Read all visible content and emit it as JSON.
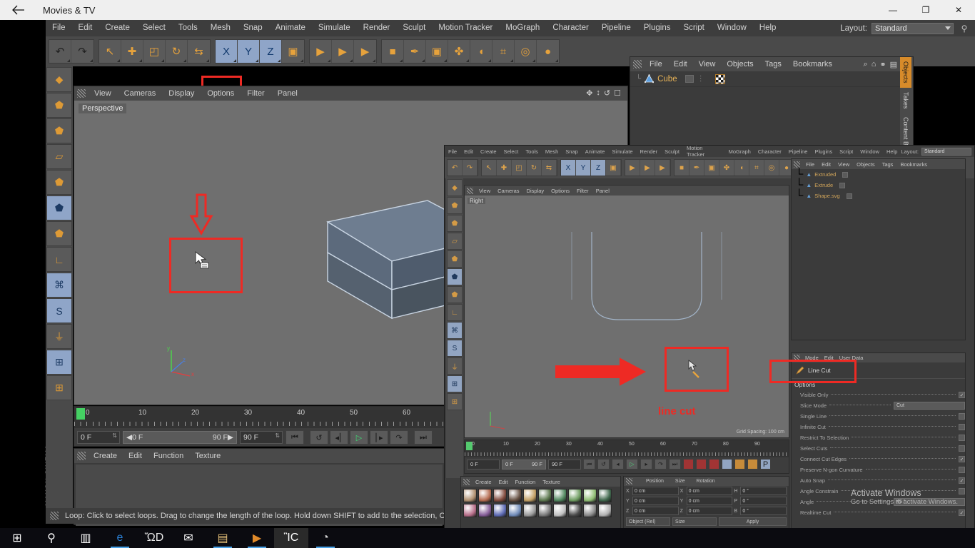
{
  "window": {
    "app_title": "Movies & TV",
    "back_icon": "back-arrow-icon",
    "minimize": "—",
    "maximize": "❐",
    "close": "✕"
  },
  "c4d": {
    "menu": [
      "File",
      "Edit",
      "Create",
      "Select",
      "Tools",
      "Mesh",
      "Snap",
      "Animate",
      "Simulate",
      "Render",
      "Sculpt",
      "Motion Tracker",
      "MoGraph",
      "Character",
      "Pipeline",
      "Plugins",
      "Script",
      "Window",
      "Help"
    ],
    "layout_label": "Layout:",
    "layout_value": "Standard",
    "search_icon": "search-icon",
    "brand": "MAXON CINEMA 4D",
    "status_text": "Loop: Click to select loops. Drag to change the length of the loop. Hold down SHIFT to add to the selection, CTR"
  },
  "toolbar": {
    "groups": [
      {
        "name": "undo-redo",
        "items": [
          {
            "icon": "undo-icon",
            "glyph": "↶",
            "selected": false
          },
          {
            "icon": "redo-icon",
            "glyph": "↷",
            "selected": false
          }
        ]
      },
      {
        "name": "transform",
        "items": [
          {
            "icon": "live-selection-icon",
            "glyph": "↖",
            "selected": false
          },
          {
            "icon": "move-icon",
            "glyph": "✚",
            "selected": false
          },
          {
            "icon": "scale-icon",
            "glyph": "◰",
            "selected": false
          },
          {
            "icon": "rotate-icon",
            "glyph": "↻",
            "selected": false
          },
          {
            "icon": "loop-selection-icon",
            "glyph": "⇆",
            "selected": false
          }
        ]
      },
      {
        "name": "axis-lock",
        "items": [
          {
            "icon": "axis-x-icon",
            "glyph": "X",
            "selected": true
          },
          {
            "icon": "axis-y-icon",
            "glyph": "Y",
            "selected": true
          },
          {
            "icon": "axis-z-icon",
            "glyph": "Z",
            "selected": true
          },
          {
            "icon": "world-object-axis-icon",
            "glyph": "▣",
            "selected": false
          }
        ]
      },
      {
        "name": "render",
        "items": [
          {
            "icon": "render-view-icon",
            "glyph": "▶",
            "selected": false
          },
          {
            "icon": "render-region-icon",
            "glyph": "▶",
            "selected": false
          },
          {
            "icon": "render-settings-icon",
            "glyph": "▶",
            "selected": false
          }
        ]
      },
      {
        "name": "objects",
        "items": [
          {
            "icon": "cube-primitive-icon",
            "glyph": "■",
            "selected": false
          },
          {
            "icon": "spline-pen-icon",
            "glyph": "✒",
            "selected": false
          },
          {
            "icon": "generator-icon",
            "glyph": "▣",
            "selected": false
          },
          {
            "icon": "mograph-icon",
            "glyph": "✤",
            "selected": false
          },
          {
            "icon": "deformer-icon",
            "glyph": "◖",
            "selected": false
          },
          {
            "icon": "scene-grid-icon",
            "glyph": "⌗",
            "selected": false
          },
          {
            "icon": "camera-icon",
            "glyph": "◎",
            "selected": false
          },
          {
            "icon": "light-icon",
            "glyph": "●",
            "selected": false
          }
        ]
      }
    ],
    "highlighted_tool": "loop-selection-icon"
  },
  "left_toolbar": [
    {
      "icon": "model-mode-icon",
      "glyph": "◆",
      "selected": false
    },
    {
      "icon": "object-mode-icon",
      "glyph": "⬟",
      "selected": false
    },
    {
      "icon": "texture-mode-icon",
      "glyph": "⬟",
      "selected": false
    },
    {
      "icon": "workplane-mode-icon",
      "glyph": "▱",
      "selected": false
    },
    {
      "icon": "point-mode-icon",
      "glyph": "⬟",
      "selected": false
    },
    {
      "icon": "edge-mode-icon",
      "glyph": "⬟",
      "selected": true
    },
    {
      "icon": "polygon-mode-icon",
      "glyph": "⬟",
      "selected": false
    },
    {
      "icon": "axis-mode-icon",
      "glyph": "∟",
      "selected": false
    },
    {
      "icon": "viewport-solo-icon",
      "glyph": "⌘",
      "selected": true
    },
    {
      "icon": "snap-toggle-icon",
      "glyph": "S",
      "selected": true
    },
    {
      "icon": "magnet-icon",
      "glyph": "⏚",
      "selected": false
    },
    {
      "icon": "workplane-lock-icon",
      "glyph": "⊞",
      "selected": true
    },
    {
      "icon": "workplane-grid-icon",
      "glyph": "⊞",
      "selected": false
    }
  ],
  "viewport": {
    "menu": [
      "View",
      "Cameras",
      "Display",
      "Options",
      "Filter",
      "Panel"
    ],
    "label": "Perspective",
    "axis_labels": {
      "x": "x",
      "y": "y",
      "z": "z"
    },
    "nav_icons": [
      "pan-icon",
      "zoom-icon",
      "rotate-icon",
      "maximize-icon"
    ]
  },
  "object_manager": {
    "menu": [
      "File",
      "Edit",
      "View",
      "Objects",
      "Tags",
      "Bookmarks"
    ],
    "items": [
      {
        "name": "Cube",
        "icon": "cube-object-icon"
      }
    ],
    "header_icons": [
      "search-icon",
      "home-icon",
      "link-icon",
      "layers-icon"
    ],
    "side_tabs": [
      "Objects",
      "Takes",
      "Content Browser"
    ]
  },
  "timeline": {
    "ticks": [
      "0",
      "10",
      "20",
      "30",
      "40",
      "50",
      "60"
    ],
    "current_frame": "0 F",
    "range_start": "0 F",
    "range_end": "90 F",
    "end_frame": "90 F",
    "buttons": [
      "go-to-start-icon",
      "loop-icon",
      "step-back-icon",
      "play-icon",
      "step-forward-icon",
      "record-icon",
      "go-to-end-icon"
    ]
  },
  "material_manager": {
    "menu": [
      "Create",
      "Edit",
      "Function",
      "Texture"
    ]
  },
  "coordinate_manager": {
    "title": "Position",
    "rows": [
      {
        "label": "X",
        "value": "0 cm"
      },
      {
        "label": "Y",
        "value": "0 cm"
      },
      {
        "label": "Z",
        "value": "0 cm"
      }
    ],
    "mode": "Object ("
  },
  "inner_window": {
    "menu": [
      "File",
      "Edit",
      "Create",
      "Select",
      "Tools",
      "Mesh",
      "Snap",
      "Animate",
      "Simulate",
      "Render",
      "Sculpt",
      "Motion Tracker",
      "MoGraph",
      "Character",
      "Pipeline",
      "Plugins",
      "Script",
      "Window",
      "Help"
    ],
    "layout_label": "Layout:",
    "layout_value": "Standard",
    "viewport": {
      "menu": [
        "View",
        "Cameras",
        "Display",
        "Options",
        "Filter",
        "Panel"
      ],
      "label": "Right",
      "grid_text": "Grid Spacing: 100 cm"
    },
    "object_manager": {
      "menu": [
        "File",
        "Edit",
        "View",
        "Objects",
        "Tags",
        "Bookmarks"
      ],
      "items": [
        {
          "name": "Extruded",
          "icon": "polygon-object-icon"
        },
        {
          "name": "Extrude",
          "icon": "extrude-generator-icon"
        },
        {
          "name": "Shape.svg",
          "icon": "spline-object-icon"
        }
      ]
    },
    "attributes": {
      "menu": [
        "Mode",
        "Edit",
        "User Data"
      ],
      "tool_title": "Line Cut",
      "tool_icon": "line-cut-icon",
      "section": "Options",
      "options": [
        {
          "label": "Visible Only",
          "type": "check",
          "checked": true
        },
        {
          "label": "Slice Mode",
          "type": "dropdown",
          "value": "Cut"
        },
        {
          "label": "Single Line",
          "type": "check",
          "checked": false
        },
        {
          "label": "Infinite Cut",
          "type": "check",
          "checked": false
        },
        {
          "label": "Restrict To Selection",
          "type": "check",
          "checked": false
        },
        {
          "label": "Select Cuts",
          "type": "check",
          "checked": false
        },
        {
          "label": "Connect Cut Edges",
          "type": "check",
          "checked": true
        },
        {
          "label": "Preserve N-gon Curvature",
          "type": "check",
          "checked": false
        },
        {
          "label": "Auto Snap",
          "type": "check",
          "checked": true
        },
        {
          "label": "Angle Constrain",
          "type": "check",
          "checked": false
        },
        {
          "label": "Angle",
          "type": "field",
          "value": "45 °"
        },
        {
          "label": "Realtime Cut",
          "type": "check",
          "checked": true
        }
      ]
    },
    "timeline": {
      "ticks": [
        "0",
        "10",
        "20",
        "30",
        "40",
        "50",
        "60",
        "70",
        "80",
        "90"
      ],
      "current_frame": "0 F",
      "range_start": "0 F",
      "range_end": "90 F",
      "end_frame": "90 F"
    },
    "material_manager": {
      "menu": [
        "Create",
        "Edit",
        "Function",
        "Texture"
      ]
    },
    "coordinate_manager": {
      "columns": [
        "Position",
        "Size",
        "Rotation"
      ],
      "rows": [
        {
          "axis": "X",
          "position": "0 cm",
          "size": "0 cm",
          "rot_label": "H",
          "rotation": "0 °"
        },
        {
          "axis": "Y",
          "position": "0 cm",
          "size": "0 cm",
          "rot_label": "P",
          "rotation": "0 °"
        },
        {
          "axis": "Z",
          "position": "0 cm",
          "size": "0 cm",
          "rot_label": "B",
          "rotation": "0 °"
        }
      ],
      "mode_left": "Object (Rel)",
      "mode_right": "Size",
      "apply": "Apply"
    }
  },
  "annotations": {
    "line_cut_label": "line cut",
    "accent_color": "#ee2a24"
  },
  "activate_windows": {
    "line1": "Activate Windows",
    "line2": "Go to Settings to activate Windows."
  },
  "taskbar": [
    {
      "name": "start-icon",
      "glyph": "⊞",
      "active": false
    },
    {
      "name": "search-icon",
      "glyph": "⚲",
      "active": false
    },
    {
      "name": "task-view-icon",
      "glyph": "▥",
      "active": false
    },
    {
      "name": "edge-browser-icon",
      "glyph": "e",
      "active": false
    },
    {
      "name": "microsoft-store-icon",
      "glyph": "ὬD",
      "active": false
    },
    {
      "name": "mail-icon",
      "glyph": "✉",
      "active": false
    },
    {
      "name": "file-explorer-icon",
      "glyph": "▤",
      "active": false
    },
    {
      "name": "media-player-icon",
      "glyph": "▶",
      "active": false
    },
    {
      "name": "movies-tv-icon",
      "glyph": "ἺC",
      "active": true
    },
    {
      "name": "chrome-icon",
      "glyph": "◔",
      "active": false
    }
  ]
}
